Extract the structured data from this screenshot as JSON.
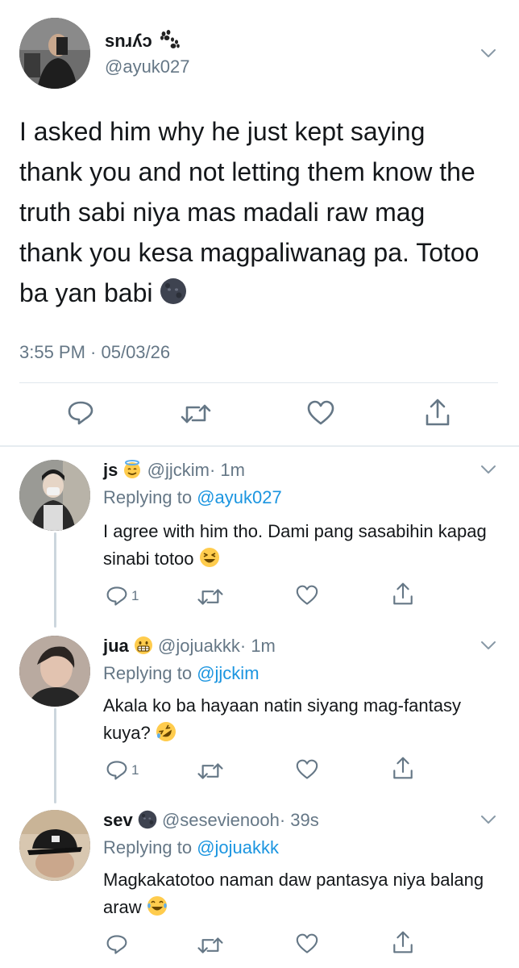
{
  "main": {
    "name": "snɹʎɔ",
    "name_emoji": "paw-prints",
    "handle": "@ayuk027",
    "text": "I asked him why he just kept saying thank you and not letting them know the truth sabi niya mas madali raw mag thank you kesa magpaliwanag pa. Totoo ba yan babi",
    "text_emoji": "new-moon-face",
    "timestamp": "3:55 PM · 05/03/26"
  },
  "replies": [
    {
      "name": "js",
      "name_emoji": "smiling-face-with-halo",
      "handle": "@jjckim",
      "time": "· 1m",
      "replying_prefix": "Replying to",
      "replying_to": "@ayuk027",
      "text": "I agree with him tho. Dami pang sasabihin kapag sinabi totoo",
      "text_emoji": "laughing-squinting-face",
      "reply_count": "1"
    },
    {
      "name": "jua",
      "name_emoji": "grimacing-face",
      "handle": "@jojuakkk",
      "time": "· 1m",
      "replying_prefix": "Replying to",
      "replying_to": "@jjckim",
      "text": "Akala ko ba hayaan natin siyang mag-fantasy kuya?",
      "text_emoji": "rolling-on-floor-laughing",
      "reply_count": "1"
    },
    {
      "name": "sev",
      "name_emoji": "new-moon-face",
      "handle": "@sesevienooh",
      "time": "· 39s",
      "replying_prefix": "Replying to",
      "replying_to": "@jojuakkk",
      "text": "Magkakatotoo naman daw pantasya niya balang araw",
      "text_emoji": "face-with-tears-of-joy",
      "reply_count": ""
    }
  ],
  "colors": {
    "link": "#1b95e0",
    "muted": "#657786",
    "icon": "#657786",
    "divider": "#e1e8ed"
  }
}
